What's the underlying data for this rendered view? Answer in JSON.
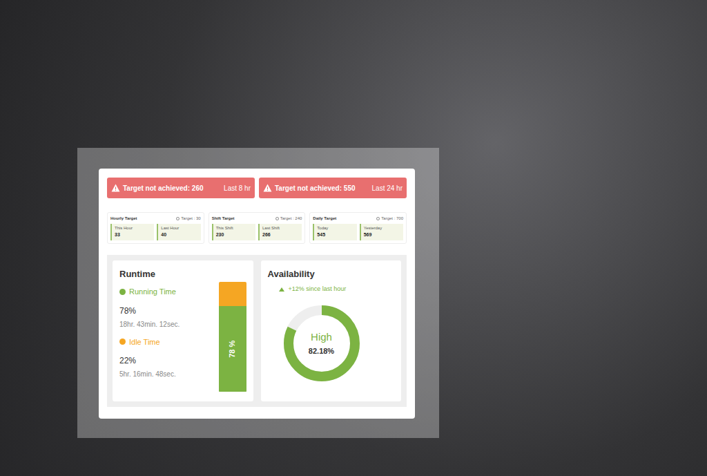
{
  "alerts": [
    {
      "message": "Target not achieved: 260",
      "period": "Last 8 hr"
    },
    {
      "message": "Target not achieved: 550",
      "period": "Last 24 hr"
    }
  ],
  "targets": [
    {
      "title": "Hourly Target",
      "target": "Target : 30",
      "values": [
        {
          "label": "This Hour",
          "value": "33"
        },
        {
          "label": "Last Hour",
          "value": "40"
        }
      ]
    },
    {
      "title": "Shift Target",
      "target": "Target : 240",
      "values": [
        {
          "label": "This Shift",
          "value": "230"
        },
        {
          "label": "Last Shift",
          "value": "266"
        }
      ]
    },
    {
      "title": "Daily Target",
      "target": "Target : 700",
      "values": [
        {
          "label": "Today",
          "value": "545"
        },
        {
          "label": "Yesterday",
          "value": "569"
        }
      ]
    }
  ],
  "runtime": {
    "title": "Runtime",
    "level": 0.78,
    "bar_label": "78 %",
    "items": [
      {
        "label": "Running Time",
        "percent": "78%",
        "duration": "18hr. 43min. 12sec.",
        "color": "#7cb342"
      },
      {
        "label": "Idle Time",
        "percent": "22%",
        "duration": "5hr. 16min. 48sec.",
        "color": "#f5a623"
      }
    ]
  },
  "availability": {
    "title": "Availability",
    "change": "+12% since last hour",
    "status": "High",
    "value": "82.18%",
    "level": 0.8218
  }
}
